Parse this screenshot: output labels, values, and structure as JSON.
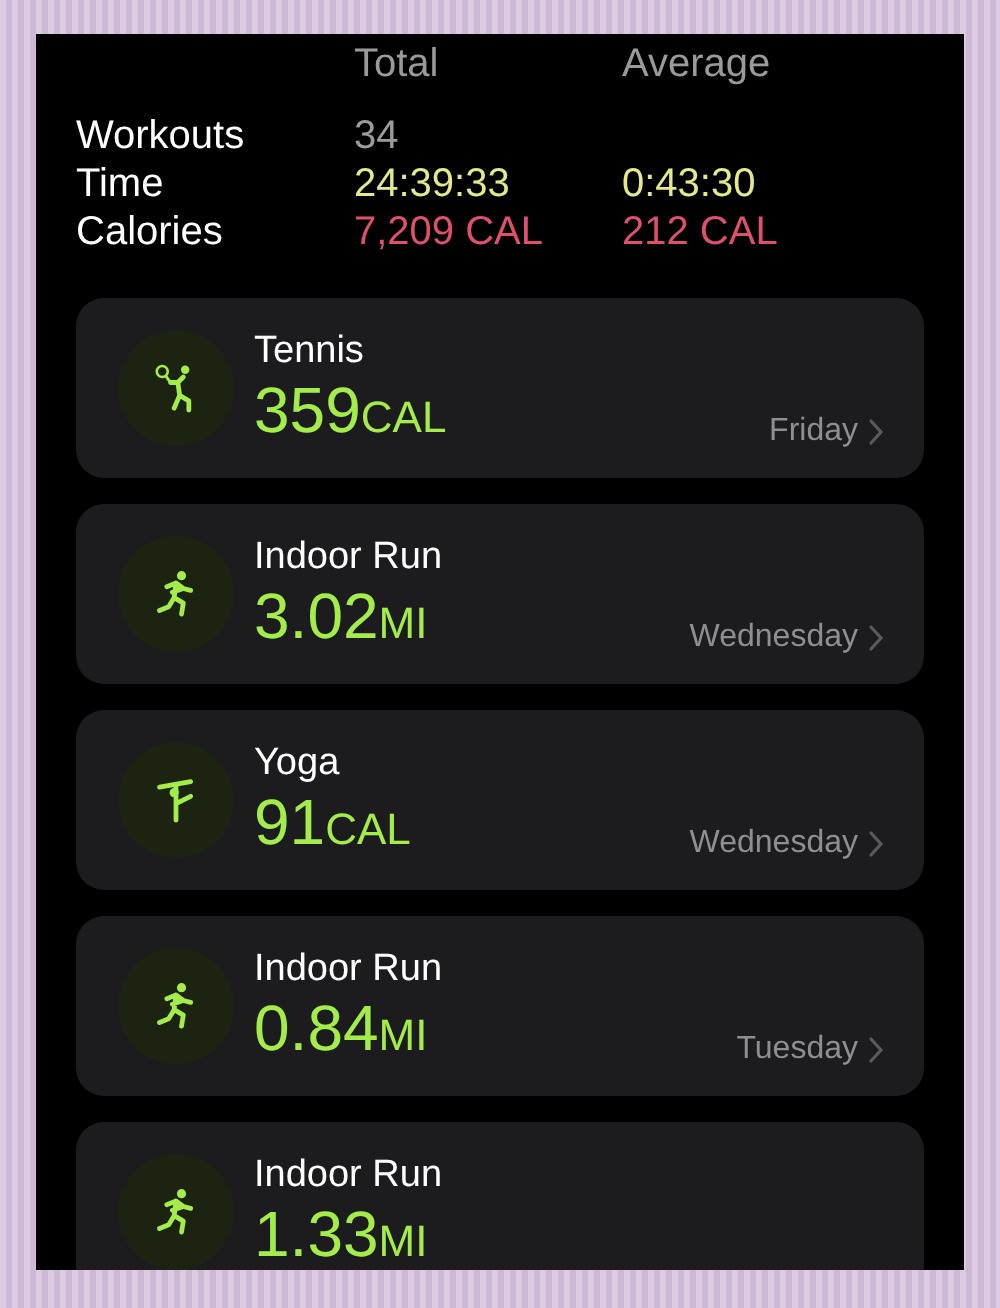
{
  "columns": [
    "Total",
    "Average"
  ],
  "summary": [
    {
      "label": "Workouts",
      "kind": "count",
      "total": "34"
    },
    {
      "label": "Time",
      "kind": "time",
      "total": "24:39:33",
      "average": "0:43:30"
    },
    {
      "label": "Calories",
      "kind": "calories",
      "total": "7,209 CAL",
      "average": "212 CAL"
    }
  ],
  "workouts": [
    {
      "name": "Tennis",
      "kind": "tennis",
      "value": "359",
      "unit": "CAL",
      "day": "Friday"
    },
    {
      "name": "Indoor Run",
      "kind": "run",
      "value": "3.02",
      "unit": "MI",
      "day": "Wednesday"
    },
    {
      "name": "Yoga",
      "kind": "yoga",
      "value": "91",
      "unit": "CAL",
      "day": "Wednesday"
    },
    {
      "name": "Indoor Run",
      "kind": "run",
      "value": "0.84",
      "unit": "MI",
      "day": "Tuesday"
    },
    {
      "name": "Indoor Run",
      "kind": "run",
      "value": "1.33",
      "unit": "MI"
    }
  ]
}
